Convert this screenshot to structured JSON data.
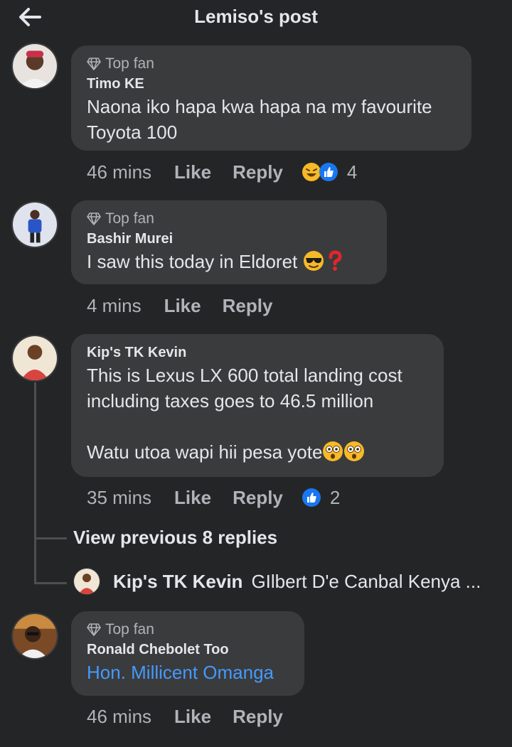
{
  "header": {
    "title": "Lemiso's post",
    "back_icon": "arrow-left-icon"
  },
  "comments": [
    {
      "badge": "Top fan",
      "author": "Timo KE",
      "lines": "Naona iko hapa kwa hapa na my favourite\nToyota 100",
      "time": "46 mins",
      "like": "Like",
      "reply": "Reply",
      "reactions": [
        "laughing-emoji",
        "like-icon"
      ],
      "reaction_count": "4"
    },
    {
      "badge": "Top fan",
      "author": "Bashir Murei",
      "text": "I saw this today in Eldoret",
      "trailing_emojis": [
        "sunglasses-emoji",
        "red-question-mark-emoji"
      ],
      "time": "4 mins",
      "like": "Like",
      "reply": "Reply"
    },
    {
      "author": "Kip's TK Kevin",
      "lines": "This is Lexus LX 600 total landing cost\nincluding taxes goes to 46.5 million",
      "text2": "Watu utoa wapi hii pesa yote",
      "trailing_emojis": [
        "flushed-face-emoji",
        "flushed-face-emoji"
      ],
      "time": "35 mins",
      "like": "Like",
      "reply": "Reply",
      "reactions": [
        "like-icon"
      ],
      "reaction_count": "2"
    },
    {
      "badge": "Top fan",
      "author": "Ronald Chebolet Too",
      "link_text": "Hon. Millicent Omanga",
      "time": "46 mins",
      "like": "Like",
      "reply": "Reply"
    }
  ],
  "thread": {
    "view_previous": "View previous 8 replies",
    "reply_author": "Kip's TK Kevin",
    "reply_text": "GIlbert D'e Canbal  Kenya ..."
  },
  "colors": {
    "background": "#242526",
    "bubble": "#3a3b3c",
    "secondary_text": "#b0b3b8",
    "link": "#4599ff",
    "like_blue": "#1877f2"
  }
}
